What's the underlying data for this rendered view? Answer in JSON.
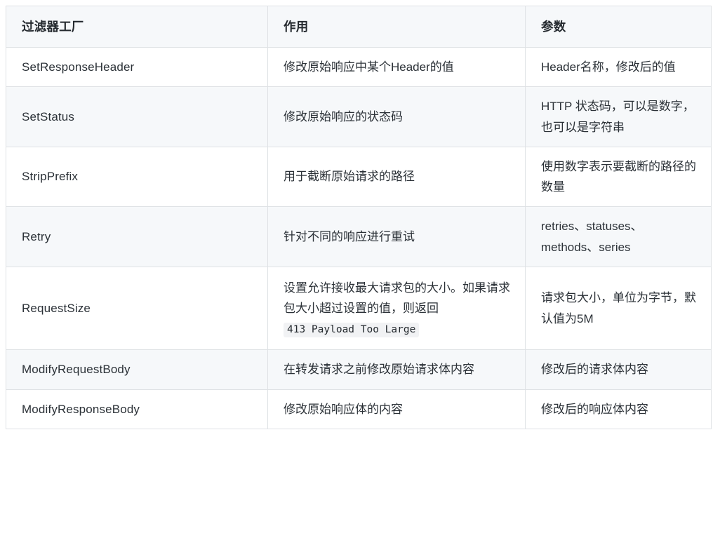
{
  "table": {
    "columns": [
      {
        "label": "过滤器工厂"
      },
      {
        "label": "作用"
      },
      {
        "label": "参数"
      }
    ],
    "rows": [
      {
        "name": "SetResponseHeader",
        "effect": "修改原始响应中某个Header的值",
        "params": "Header名称，修改后的值"
      },
      {
        "name": "SetStatus",
        "effect": "修改原始响应的状态码",
        "params": "HTTP 状态码，可以是数字，也可以是字符串"
      },
      {
        "name": "StripPrefix",
        "effect": "用于截断原始请求的路径",
        "params": "使用数字表示要截断的路径的数量"
      },
      {
        "name": "Retry",
        "effect": "针对不同的响应进行重试",
        "params": "retries、statuses、methods、series"
      },
      {
        "name": "RequestSize",
        "effect_prefix": "设置允许接收最大请求包的大小。如果请求包大小超过设置的值，则返回 ",
        "effect_code": "413 Payload Too Large",
        "effect_suffix": "",
        "params": "请求包大小，单位为字节，默认值为5M"
      },
      {
        "name": "ModifyRequestBody",
        "effect": "在转发请求之前修改原始请求体内容",
        "params": "修改后的请求体内容"
      },
      {
        "name": "ModifyResponseBody",
        "effect": "修改原始响应体的内容",
        "params": "修改后的响应体内容"
      }
    ]
  },
  "colors": {
    "header_bg": "#f6f8fa",
    "stripe_bg": "#f6f8fa",
    "border": "#dfe2e5",
    "text": "#24292e",
    "code_bg": "#f1f2f4"
  }
}
